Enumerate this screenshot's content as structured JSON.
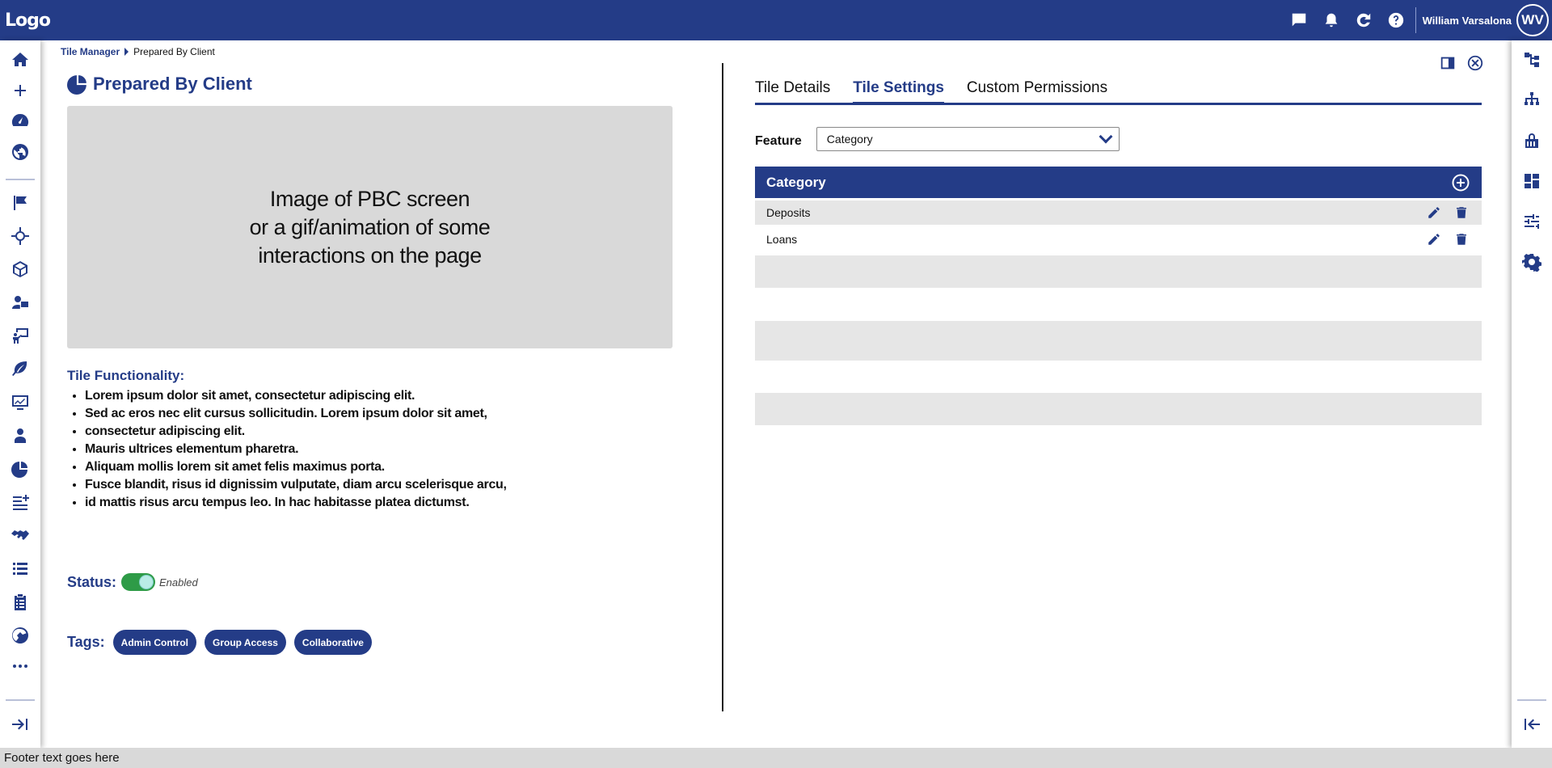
{
  "header": {
    "logo": "Logo",
    "user_name": "William Varsalona",
    "user_initials": "WV",
    "icons": [
      "chat-icon",
      "bell-icon",
      "refresh-icon",
      "help-icon"
    ]
  },
  "left_nav": {
    "items": [
      "home-icon",
      "plus-icon",
      "speedometer-icon",
      "globe-icon",
      "flag-icon",
      "target-icon",
      "cube-icon",
      "user-screen-icon",
      "presentation-icon",
      "leaf-icon",
      "monitor-chart-icon",
      "person-icon",
      "pie-chart-icon",
      "list-add-icon",
      "handshake-icon",
      "list-icon",
      "clipboard-checklist-icon",
      "globe-network-icon",
      "more-icon"
    ],
    "collapse_icon": "expand-right-icon"
  },
  "right_nav": {
    "items": [
      "workflow-icon",
      "org-chart-icon",
      "unlock-icon",
      "dashboard-icon",
      "sliders-icon",
      "gear-icon"
    ],
    "collapse_icon": "collapse-left-icon"
  },
  "breadcrumb": {
    "parent": "Tile Manager",
    "current": "Prepared By Client"
  },
  "tile": {
    "title": "Prepared By Client",
    "preview_text": "Image of PBC screen\nor a gif/animation of some\ninteractions on the page",
    "functionality_label": "Tile Functionality:",
    "functionality_items": [
      "Lorem ipsum dolor sit amet, consectetur adipiscing elit.",
      "Sed ac eros nec elit cursus sollicitudin. Lorem ipsum dolor sit amet,",
      "consectetur adipiscing elit.",
      "Mauris ultrices elementum pharetra.",
      "Aliquam mollis lorem sit amet felis maximus porta.",
      "Fusce blandit, risus id dignissim vulputate, diam arcu scelerisque arcu,",
      "id mattis risus arcu tempus leo. In hac habitasse platea dictumst."
    ],
    "status_label": "Status:",
    "status_value": "Enabled",
    "tags_label": "Tags:",
    "tags": [
      "Admin Control",
      "Group Access",
      "Collaborative"
    ]
  },
  "panel": {
    "tabs": [
      "Tile Details",
      "Tile Settings",
      "Custom Permissions"
    ],
    "active_tab": "Tile Settings",
    "feature_label": "Feature",
    "feature_value": "Category",
    "category_header": "Category",
    "rows": [
      "Deposits",
      "Loans"
    ]
  },
  "footer": {
    "text": "Footer text goes here"
  },
  "colors": {
    "primary": "#243c87",
    "toggle_on": "#2e9b47",
    "row_alt": "#e6e6e6",
    "preview_bg": "#d9d9d9"
  }
}
